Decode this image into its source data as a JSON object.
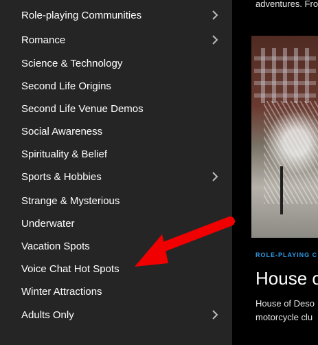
{
  "sidebar": {
    "items": [
      {
        "label": "Role-playing Communities",
        "has_submenu": true
      },
      {
        "label": "Romance",
        "has_submenu": true
      },
      {
        "label": "Science & Technology",
        "has_submenu": false
      },
      {
        "label": "Second Life Origins",
        "has_submenu": false
      },
      {
        "label": "Second Life Venue Demos",
        "has_submenu": false
      },
      {
        "label": "Social Awareness",
        "has_submenu": false
      },
      {
        "label": "Spirituality & Belief",
        "has_submenu": false
      },
      {
        "label": "Sports & Hobbies",
        "has_submenu": true
      },
      {
        "label": "Strange & Mysterious",
        "has_submenu": false
      },
      {
        "label": "Underwater",
        "has_submenu": false
      },
      {
        "label": "Vacation Spots",
        "has_submenu": false
      },
      {
        "label": "Voice Chat Hot Spots",
        "has_submenu": false
      },
      {
        "label": "Winter Attractions",
        "has_submenu": false
      },
      {
        "label": "Adults Only",
        "has_submenu": true
      }
    ]
  },
  "content": {
    "top_snippet": "adventures. Fro",
    "category": "ROLE-PLAYING C",
    "post_title": "House o",
    "excerpt_line1": "House of Deso",
    "excerpt_line2": "motorcycle clu"
  },
  "colors": {
    "sidebar_bg": "#252525",
    "page_bg": "#000000",
    "accent": "#2f9be6",
    "annotation_arrow": "#f00000"
  },
  "icons": {
    "submenu": "chevron-right-icon",
    "annotation": "red-arrow-annotation"
  }
}
